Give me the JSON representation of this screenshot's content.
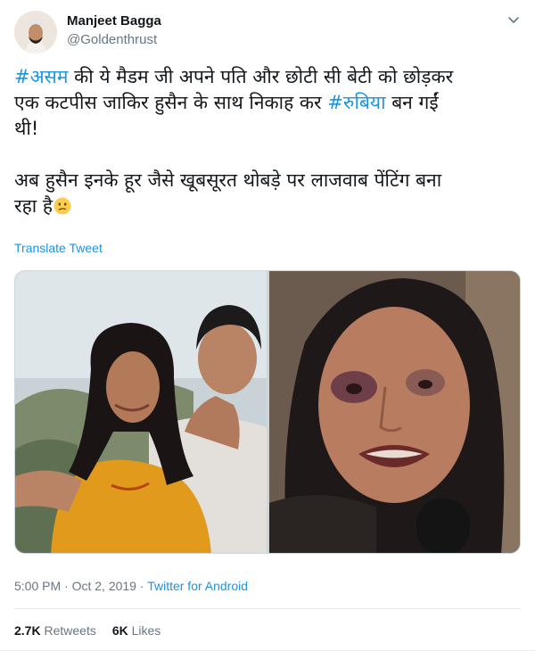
{
  "user": {
    "name": "Manjeet Bagga",
    "handle": "@Goldenthrust"
  },
  "text": {
    "hashtag1": "#असम",
    "line1_rest": " की ये मैडम जी अपने पति और छोटी सी बेटी को छोड़कर",
    "line2_start": "एक कटपीस जाकिर हुसैन के साथ निकाह कर ",
    "hashtag2": "#रुबिया",
    "line2_end": " बन गईं",
    "line3": "थी!",
    "para2_line1": "अब हुसैन इनके हूर जैसे खूबसूरत थोबड़े पर लाजवाब पेंटिंग बना",
    "para2_line2": "रहा है",
    "emoji": "confused-face-emoji"
  },
  "translate_label": "Translate Tweet",
  "meta": {
    "time": "5:00 PM",
    "sep1": " · ",
    "date": "Oct 2, 2019",
    "sep2": " · ",
    "source": "Twitter for Android"
  },
  "stats": {
    "retweets_count": "2.7K",
    "retweets_label": "Retweets",
    "likes_count": "6K",
    "likes_label": "Likes"
  },
  "colors": {
    "link": "#1b95e0",
    "secondary": "#657786",
    "primary_text": "#14171a"
  }
}
